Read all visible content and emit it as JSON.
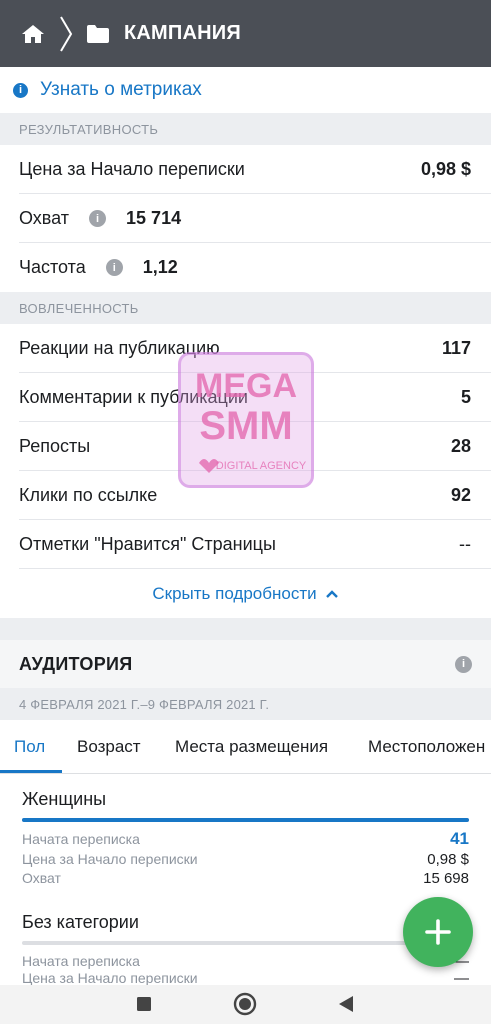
{
  "header": {
    "title": "КАМПАНИЯ"
  },
  "learn_link": "Узнать о метриках",
  "performance": {
    "section_label": "РЕЗУЛЬТАТИВНОСТЬ",
    "rows": [
      {
        "label": "Цена за Начало переписки",
        "value": "0,98 $"
      },
      {
        "label": "Охват",
        "value": "15 714"
      },
      {
        "label": "Частота",
        "value": "1,12"
      }
    ]
  },
  "engagement": {
    "section_label": "ВОВЛЕЧЕННОСТЬ",
    "rows": [
      {
        "label": "Реакции на публикацию",
        "value": "117"
      },
      {
        "label": "Комментарии к публикации",
        "value": "5"
      },
      {
        "label": "Репосты",
        "value": "28"
      },
      {
        "label": "Клики по ссылке",
        "value": "92"
      },
      {
        "label": "Отметки \"Нравится\" Страницы",
        "value": "--"
      }
    ]
  },
  "hide_details": "Скрыть подробности",
  "audience": {
    "title": "АУДИТОРИЯ",
    "date_range": "4 ФЕВРАЛЯ 2021 Г.–9 ФЕВРАЛЯ 2021 Г.",
    "tabs": [
      "Пол",
      "Возраст",
      "Места размещения",
      "Местоположен"
    ],
    "active_tab": "Пол",
    "categories": [
      {
        "name": "Женщины",
        "share": 1.0,
        "metrics": [
          {
            "label": "Начата переписка",
            "value": "41"
          },
          {
            "label": "Цена за Начало переписки",
            "value": "0,98 $"
          },
          {
            "label": "Охват",
            "value": "15 698"
          }
        ]
      },
      {
        "name": "Без категории",
        "share": 0.0,
        "metrics": [
          {
            "label": "Начата переписка",
            "value": "—"
          },
          {
            "label": "Цена за Начало переписки",
            "value": "—"
          }
        ]
      }
    ]
  },
  "watermark": {
    "line1": "MEGA",
    "line2": "SMM",
    "line3": "DIGITAL AGENCY"
  },
  "colors": {
    "accent": "#1877c6",
    "topbar": "#4b4f56",
    "fab": "#41b35d",
    "section_bg": "#eceef1"
  },
  "icons": [
    "home-icon",
    "breadcrumb-chevron-icon",
    "folder-icon",
    "info-icon",
    "chevron-up-icon",
    "plus-icon",
    "nav-recents-icon",
    "nav-home-icon",
    "nav-back-icon"
  ]
}
